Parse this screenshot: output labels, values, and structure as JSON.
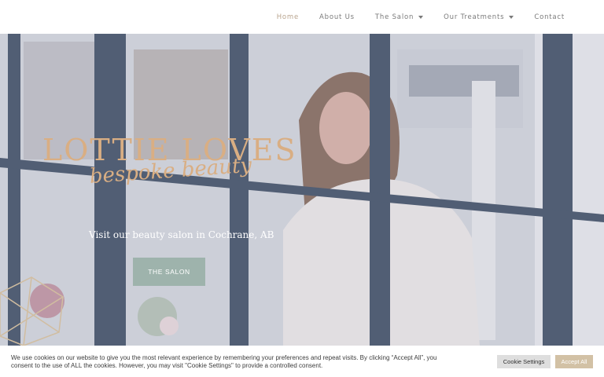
{
  "nav": {
    "items": [
      {
        "label": "Home"
      },
      {
        "label": "About Us"
      },
      {
        "label": "The Salon"
      },
      {
        "label": "Our Treatments"
      },
      {
        "label": "Contact"
      }
    ]
  },
  "hero": {
    "title": "LOTTIE LOVES",
    "subtitle": "bespoke beauty",
    "tagline": "Visit our beauty salon in Cochrane, AB",
    "button_label": "THE SALON"
  },
  "cookie": {
    "text": "We use cookies on our website to give you the most relevant experience by remembering your preferences and repeat visits. By clicking “Accept All”, you consent to the use of ALL the cookies. However, you may visit \"Cookie Settings\" to provide a controlled consent.",
    "settings_label": "Cookie Settings",
    "accept_label": "Accept All"
  },
  "colors": {
    "accent_gold": "#d9ae83",
    "button_sage": "#9eb3ac",
    "accept_tan": "#d2c1a5",
    "window_frame": "#4f5c70"
  }
}
